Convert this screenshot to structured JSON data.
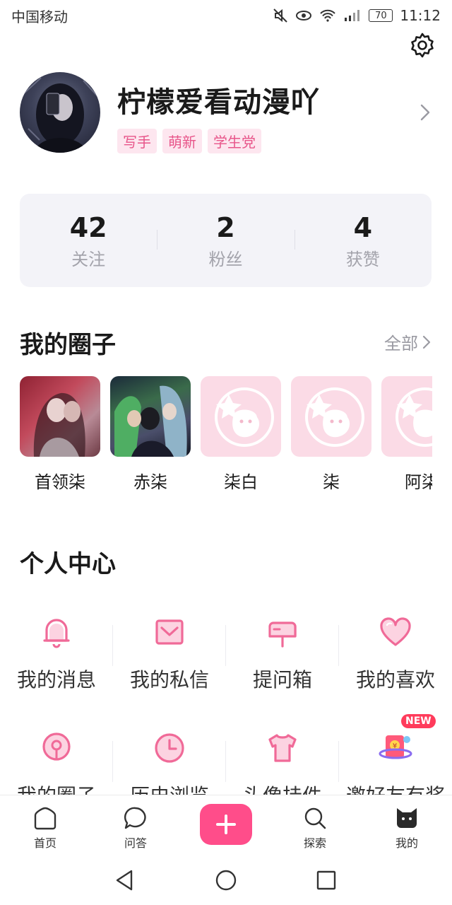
{
  "status_bar": {
    "carrier": "中国移动",
    "battery": "70",
    "time": "11:12"
  },
  "profile": {
    "username": "柠檬爱看动漫吖",
    "tags": [
      "写手",
      "萌新",
      "学生党"
    ]
  },
  "stats": [
    {
      "value": "42",
      "label": "关注"
    },
    {
      "value": "2",
      "label": "粉丝"
    },
    {
      "value": "4",
      "label": "获赞"
    }
  ],
  "circles": {
    "title": "我的圈子",
    "view_all": "全部",
    "items": [
      {
        "name": "首领柒"
      },
      {
        "name": "赤柒"
      },
      {
        "name": "柒白"
      },
      {
        "name": "柒"
      },
      {
        "name": "阿柒"
      }
    ]
  },
  "personal_center": {
    "title": "个人中心",
    "items": [
      {
        "label": "我的消息",
        "icon": "bell-icon"
      },
      {
        "label": "我的私信",
        "icon": "mail-icon"
      },
      {
        "label": "提问箱",
        "icon": "mailbox-icon"
      },
      {
        "label": "我的喜欢",
        "icon": "heart-icon"
      },
      {
        "label": "我的圈子",
        "icon": "location-circle-icon"
      },
      {
        "label": "历史浏览",
        "icon": "clock-icon"
      },
      {
        "label": "头像挂件",
        "icon": "tshirt-icon"
      },
      {
        "label": "邀好友有奖",
        "icon": "gift-planet-icon",
        "badge": "NEW"
      }
    ]
  },
  "bottom_nav": [
    {
      "label": "首页",
      "icon": "home-icon"
    },
    {
      "label": "问答",
      "icon": "chat-bubble-icon"
    },
    {
      "label": "探索",
      "icon": "search-icon"
    },
    {
      "label": "我的",
      "icon": "cat-icon"
    }
  ],
  "colors": {
    "accent": "#ff4d8a",
    "tag_bg": "#fde6ef",
    "tag_text": "#e8558a",
    "card_bg": "#f3f3f8"
  }
}
